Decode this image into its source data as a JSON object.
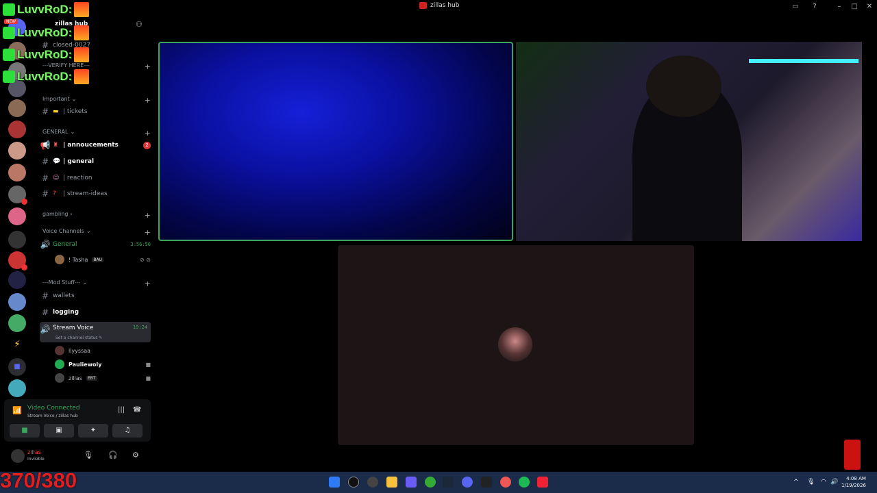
{
  "window": {
    "title": "zillas hub"
  },
  "server": {
    "name": "zillas hub"
  },
  "channels": {
    "top": "closed-0027",
    "verify_category": "---VERIFY HERE---",
    "important_category": "Important",
    "tickets": "| tickets",
    "general_category": "GENERAL",
    "annoucements": "| annoucements",
    "annoucements_badge": "2",
    "general": "| general",
    "reaction": "| reaction",
    "stream_ideas": "| stream-ideas",
    "gambling_category": "gambling",
    "voice_category": "Voice Channels",
    "voice_general": "General",
    "voice_general_timer": "3:56:50",
    "voice_general_user": "! Tasha",
    "voice_general_user_tag": "BAU",
    "mod_category": "---Mod Stuff---",
    "wallets": "wallets",
    "logging": "logging",
    "stream_voice": "Stream Voice",
    "stream_voice_timer": "19:24",
    "channel_status": "Set a channel status",
    "stream_users": [
      {
        "name": "llyyssaa"
      },
      {
        "name": "Pauliewoly"
      },
      {
        "name": "zillas",
        "tag": "EBT"
      }
    ]
  },
  "voice_panel": {
    "status": "Video Connected",
    "location": "Stream Voice / zillas hub"
  },
  "user_panel": {
    "name": "zillas",
    "status": "Invisible"
  },
  "overlay": {
    "chat_name": "LuvvRoD:",
    "new_label": "NEW",
    "counter": "370/380"
  },
  "taskbar": {
    "time": "4:08 AM",
    "date": "1/19/2026"
  },
  "colors": {
    "accent_green": "#3ba55d",
    "mention_red": "#da373c",
    "taskbar": "#1b2c4b",
    "counter_red": "#e31e1e"
  }
}
